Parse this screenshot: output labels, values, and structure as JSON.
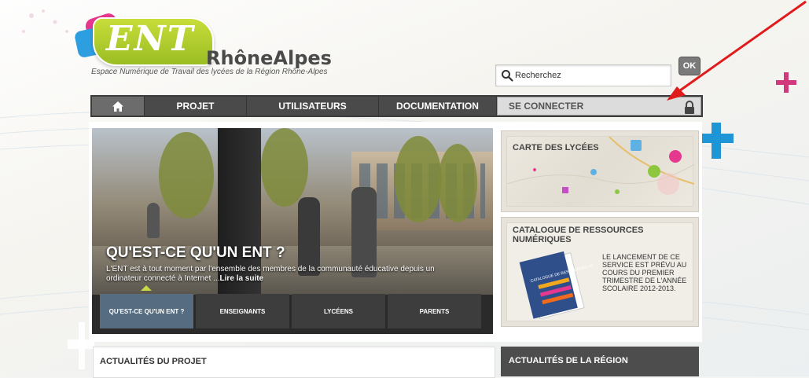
{
  "brand": {
    "logo_text": "ENT",
    "region_name": "RhôneAlpes",
    "tagline": "Espace Numérique de Travail des lycées de la Région Rhône-Alpes"
  },
  "search": {
    "value": "Recherchez",
    "ok_label": "OK"
  },
  "nav": {
    "home_icon": "home-icon",
    "items": [
      {
        "label": "PROJET"
      },
      {
        "label": "UTILISATEURS"
      },
      {
        "label": "DOCUMENTATION"
      }
    ],
    "connect_label": "SE CONNECTER",
    "lock_icon": "lock-icon"
  },
  "hero": {
    "title": "QU'EST-CE QU'UN ENT ?",
    "text": "L'ENT est à tout moment par l'ensemble des membres de la communauté éducative depuis un ordinateur connecté à Internet ...",
    "read_more": "Lire la suite",
    "tabs": [
      {
        "label": "QU'EST-CE QU'UN ENT ?",
        "active": true
      },
      {
        "label": "ENSEIGNANTS",
        "active": false
      },
      {
        "label": "LYCÉENS",
        "active": false
      },
      {
        "label": "PARENTS",
        "active": false
      }
    ]
  },
  "sidebar": {
    "map_title": "CARTE DES LYCÉES",
    "catalog_title": "CATALOGUE DE RESSOURCES NUMÉRIQUES",
    "catalog_text": "LE LANCEMENT DE CE SERVICE EST PRÉVU AU COURS DU PREMIER TRIMESTRE DE L'ANNÉE SCOLAIRE 2012-2013.",
    "book_label": "CATALOGUE DE RESSOURCES NUMÉRIQUES"
  },
  "news": {
    "project_title": "ACTUALITÉS DU PROJET",
    "region_title": "ACTUALITÉS DE LA RÉGION"
  },
  "colors": {
    "accent_green": "#9bbd23",
    "accent_pink": "#e6388e",
    "accent_blue": "#2d9ee0",
    "nav_dark": "#4a4a4a",
    "active_tab": "#566c80",
    "annotation_arrow": "#e01b1b"
  }
}
